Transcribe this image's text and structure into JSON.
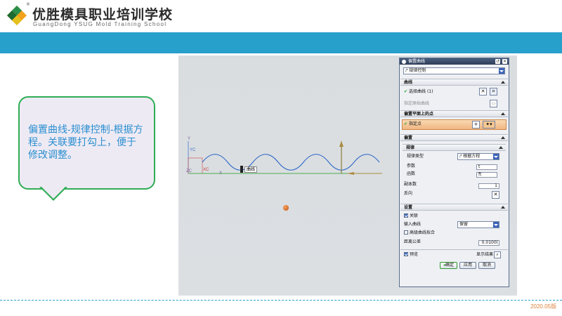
{
  "header": {
    "school_cn": "优胜模具职业培训学校",
    "school_en": "GuangDong YSUG Mold Training School",
    "reg_mark": "®"
  },
  "bubble": {
    "text": "偏置曲线-规律控制-根据方程。关联要打勾上，便于修改调整。"
  },
  "viewport": {
    "axis_yc": "YC",
    "axis_xc": "XC",
    "axis_zc": "ZC",
    "axis_y": "Y",
    "axis_x": "X",
    "curve_label": "曲线"
  },
  "dialog": {
    "title": "偏置曲线",
    "type_value": "规律控制",
    "sections": {
      "curve": "曲线",
      "offset_plane_point": "偏置平面上的点",
      "offset": "偏置",
      "law": "规律",
      "settings": "设置"
    },
    "curve_select_label": "选择曲线 (1)",
    "specify_origin_curve": "指定原始曲线",
    "specify_point": "指定点",
    "law_type_label": "规律类型",
    "law_type_value": "根据方程",
    "param_label": "参数",
    "param_value": "t",
    "func_label": "函数",
    "func_value": "ft",
    "copies_label": "副本数",
    "copies_value": "1",
    "reverse_label": "反向",
    "associative_label": "关联",
    "input_curve_label": "输入曲线",
    "input_curve_value": "保留",
    "advanced_curve_label": "高级曲线拟合",
    "distance_tol_label": "距离公差",
    "distance_tol_value": "0.0100(",
    "preview_label": "预览",
    "show_result_label": "显示结果",
    "ok_label": "确定",
    "apply_label": "应用",
    "cancel_label": "取消"
  },
  "footer": {
    "version": "2020.05版"
  },
  "colors": {
    "title_bar": "#27a0cc",
    "bubble_border": "#2fad55",
    "bubble_text": "#2a8fd0",
    "curve": "#2f67c7",
    "version": "#e0833d"
  }
}
